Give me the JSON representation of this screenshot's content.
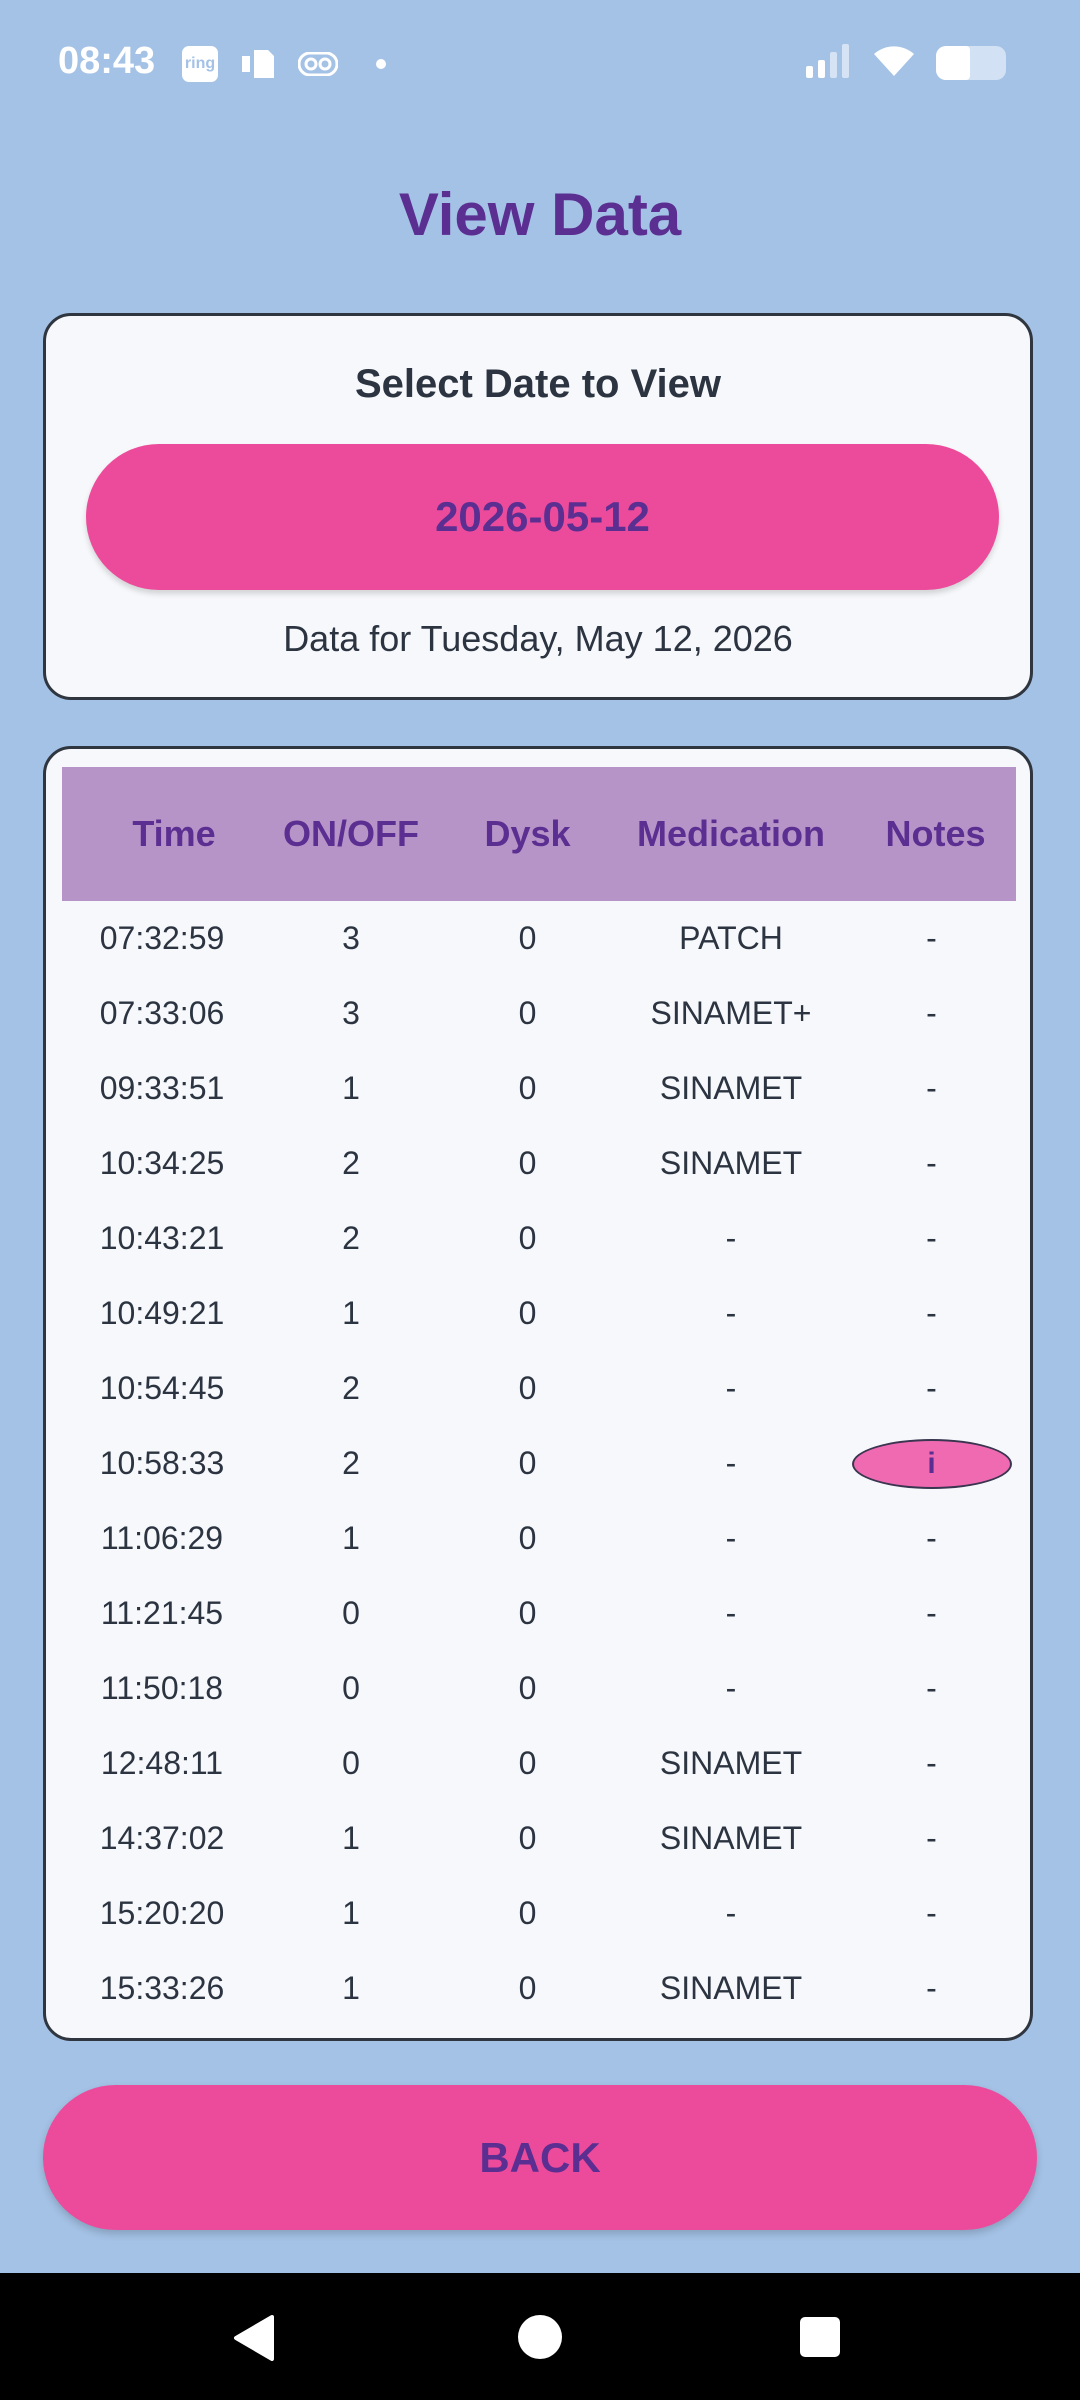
{
  "status_bar": {
    "time": "08:43",
    "ring_label": "ring"
  },
  "page": {
    "title": "View Data"
  },
  "date_selector": {
    "heading": "Select Date to View",
    "selected_date": "2026-05-12",
    "subtitle": "Data for Tuesday, May 12, 2026"
  },
  "table": {
    "columns": [
      "Time",
      "ON/OFF",
      "Dysk",
      "Medication",
      "Notes"
    ],
    "rows": [
      {
        "time": "07:32:59",
        "onoff": "3",
        "dysk": "0",
        "medication": "PATCH",
        "notes": "-"
      },
      {
        "time": "07:33:06",
        "onoff": "3",
        "dysk": "0",
        "medication": "SINAMET+",
        "notes": "-"
      },
      {
        "time": "09:33:51",
        "onoff": "1",
        "dysk": "0",
        "medication": "SINAMET",
        "notes": "-"
      },
      {
        "time": "10:34:25",
        "onoff": "2",
        "dysk": "0",
        "medication": "SINAMET",
        "notes": "-"
      },
      {
        "time": "10:43:21",
        "onoff": "2",
        "dysk": "0",
        "medication": "-",
        "notes": "-"
      },
      {
        "time": "10:49:21",
        "onoff": "1",
        "dysk": "0",
        "medication": "-",
        "notes": "-"
      },
      {
        "time": "10:54:45",
        "onoff": "2",
        "dysk": "0",
        "medication": "-",
        "notes": "-"
      },
      {
        "time": "10:58:33",
        "onoff": "2",
        "dysk": "0",
        "medication": "-",
        "notes": "i"
      },
      {
        "time": "11:06:29",
        "onoff": "1",
        "dysk": "0",
        "medication": "-",
        "notes": "-"
      },
      {
        "time": "11:21:45",
        "onoff": "0",
        "dysk": "0",
        "medication": "-",
        "notes": "-"
      },
      {
        "time": "11:50:18",
        "onoff": "0",
        "dysk": "0",
        "medication": "-",
        "notes": "-"
      },
      {
        "time": "12:48:11",
        "onoff": "0",
        "dysk": "0",
        "medication": "SINAMET",
        "notes": "-"
      },
      {
        "time": "14:37:02",
        "onoff": "1",
        "dysk": "0",
        "medication": "SINAMET",
        "notes": "-"
      },
      {
        "time": "15:20:20",
        "onoff": "1",
        "dysk": "0",
        "medication": "-",
        "notes": "-"
      },
      {
        "time": "15:33:26",
        "onoff": "1",
        "dysk": "0",
        "medication": "SINAMET",
        "notes": "-"
      }
    ]
  },
  "actions": {
    "back_label": "BACK"
  },
  "colors": {
    "background": "#a4c2e6",
    "accent_pink": "#ec4b9b",
    "title_purple": "#5b2e91",
    "header_purple": "#b794c8"
  },
  "icons": {
    "status_left": [
      "ring-icon",
      "sim-card-icon",
      "voicemail-icon",
      "dot-icon"
    ],
    "status_right": [
      "signal-icon",
      "wifi-icon",
      "battery-icon"
    ],
    "nav": [
      "nav-back-icon",
      "nav-home-icon",
      "nav-recents-icon"
    ]
  }
}
